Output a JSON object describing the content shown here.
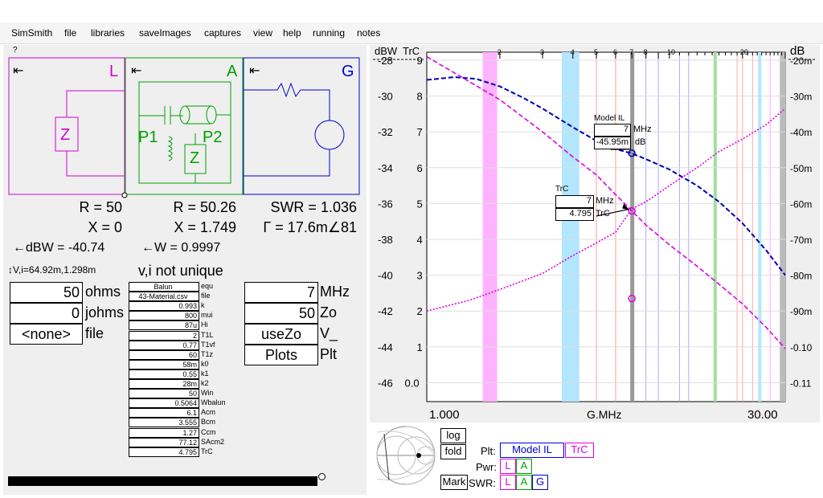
{
  "menu": [
    "SimSmith",
    "file",
    "libraries",
    "saveImages",
    "captures",
    "view",
    "help",
    "running",
    "notes"
  ],
  "help_mark": "?",
  "circuit": {
    "L": {
      "letter": "L",
      "arrow": "⇤",
      "element_label": "Z",
      "color": "#d000d0"
    },
    "A": {
      "letter": "A",
      "arrow": "⇤",
      "p1": "P1",
      "p2": "P2",
      "element_label": "Z",
      "color": "#00a000"
    },
    "G": {
      "letter": "G",
      "arrow": "⇤",
      "color": "#0000d0"
    }
  },
  "readouts": {
    "L_R": "R = 50",
    "L_X": "X = 0",
    "L_dbw": "←dBW = -40.74",
    "L_vi": "↕V,i=64.92m,1.298m",
    "A_R": "R = 50.26",
    "A_X": "X = 1.749",
    "A_W": "←W = 0.9997",
    "A_vi": "v,i not unique",
    "G_swr": "SWR = 1.036",
    "G_gamma": "Γ = 17.6m∠81"
  },
  "load_fields": [
    {
      "value": "50",
      "label": "ohms"
    },
    {
      "value": "0",
      "label": "johms"
    },
    {
      "value": "<none>",
      "label": "file"
    }
  ],
  "gen_fields": [
    {
      "value": "7",
      "label": "MHz"
    },
    {
      "value": "50",
      "label": "Zo"
    },
    {
      "value": "useZo",
      "label": "V_"
    },
    {
      "value": "Plots",
      "label": "Plt"
    }
  ],
  "params": [
    {
      "value": "Balun",
      "label": "equ"
    },
    {
      "value": "43-Material.csv",
      "label": "file"
    },
    {
      "value": "0.993",
      "label": "k"
    },
    {
      "value": "800",
      "label": "mui"
    },
    {
      "value": "87u",
      "label": "Hi"
    },
    {
      "value": "2",
      "label": "T1L"
    },
    {
      "value": "0.77",
      "label": "T1vf"
    },
    {
      "value": "60",
      "label": "T1z"
    },
    {
      "value": "58m",
      "label": "k0"
    },
    {
      "value": "0.55",
      "label": "k1"
    },
    {
      "value": "28m",
      "label": "k2"
    },
    {
      "value": "50",
      "label": "Win"
    },
    {
      "value": "0.5064",
      "label": "Wbalun"
    },
    {
      "value": "6.1",
      "label": "Acm"
    },
    {
      "value": "3.555",
      "label": "Bcm"
    },
    {
      "value": "1.27",
      "label": "Ccm"
    },
    {
      "value": "77.12",
      "label": "SAcm2"
    },
    {
      "value": "4.795",
      "label": "TrC"
    }
  ],
  "chart": {
    "left_axis_title": "dBW",
    "left_axis2_title": "TrC",
    "right_axis_title": "dB",
    "dbw_ticks": [
      "-28",
      "-30",
      "-32",
      "-34",
      "-36",
      "-38",
      "-40",
      "-42",
      "-44",
      "-46"
    ],
    "trc_ticks": [
      "9",
      "8",
      "7",
      "6",
      "5",
      "4",
      "3",
      "2",
      "1",
      "0.0"
    ],
    "db_ticks": [
      "-20m",
      "-30m",
      "-40m",
      "-50m",
      "-60m",
      "-70m",
      "-80m",
      "-90m",
      "-0.10",
      "-0.11"
    ],
    "top_ticks": [
      "2",
      "3",
      "4",
      "5",
      "6",
      "7",
      "8",
      "10",
      "20"
    ],
    "x_min_label": "1.000",
    "x_unit_label": "G.MHz",
    "x_max_label": "30.00",
    "marker1": {
      "title": "Model IL",
      "freq": "7",
      "freq_unit": "MHz",
      "value": "-45.95m",
      "value_unit": "dB"
    },
    "marker2": {
      "title": "TrC",
      "freq": "7",
      "freq_unit": "MHz",
      "value": "4.795",
      "value_unit": "TrC"
    },
    "colors": {
      "model_il": "#0000b0",
      "trc": "#e000e0",
      "cursor": "#999999",
      "band_pink": "#ffb3ff",
      "band_blue": "#b3e6ff",
      "band_green": "#a0e0a0"
    }
  },
  "chart_data": {
    "type": "line",
    "x_scale": "log",
    "xlim": [
      1,
      30
    ],
    "series": [
      {
        "name": "Model IL",
        "axis": "dB",
        "x": [
          1,
          1.3,
          1.6,
          2,
          2.5,
          3,
          4,
          5,
          6,
          7,
          8,
          10,
          13,
          16,
          20,
          25,
          30
        ],
        "values": [
          -0.0255,
          -0.0247,
          -0.0252,
          -0.0273,
          -0.0305,
          -0.0335,
          -0.0387,
          -0.0425,
          -0.0448,
          -0.046,
          -0.0476,
          -0.0505,
          -0.055,
          -0.0595,
          -0.0655,
          -0.073,
          -0.08
        ]
      },
      {
        "name": "TrC",
        "axis": "TrC",
        "x": [
          1,
          1.5,
          2,
          3,
          4,
          5,
          6,
          7,
          8,
          10,
          13,
          16,
          20,
          25,
          30
        ],
        "values": [
          9.1,
          8.4,
          7.9,
          7.0,
          6.3,
          5.8,
          5.25,
          4.795,
          4.4,
          3.85,
          3.25,
          2.75,
          2.2,
          1.55,
          0.95
        ]
      },
      {
        "axis": "dBW",
        "x": [
          1,
          1.5,
          2,
          3,
          4,
          5,
          6,
          7,
          8,
          10,
          13,
          16,
          20,
          25,
          30
        ],
        "values": [
          -42,
          -41.4,
          -40.8,
          -39.9,
          -38.9,
          -38.2,
          -37.6,
          -36.3,
          -35.9,
          -35.0,
          -34.0,
          -33.1,
          -32.4,
          -31.6,
          -30.7
        ]
      }
    ],
    "cursor_x": 7
  },
  "controls": {
    "log": "log",
    "fold": "fold",
    "mark": "Mark",
    "plt_label": "Plt:",
    "plt1": "Model IL",
    "plt2": "TrC",
    "pwr_label": "Pwr:",
    "pwr1": "L",
    "pwr2": "A",
    "swr_label": "SWR:",
    "swr1": "L",
    "swr2": "A",
    "swr3": "G"
  }
}
